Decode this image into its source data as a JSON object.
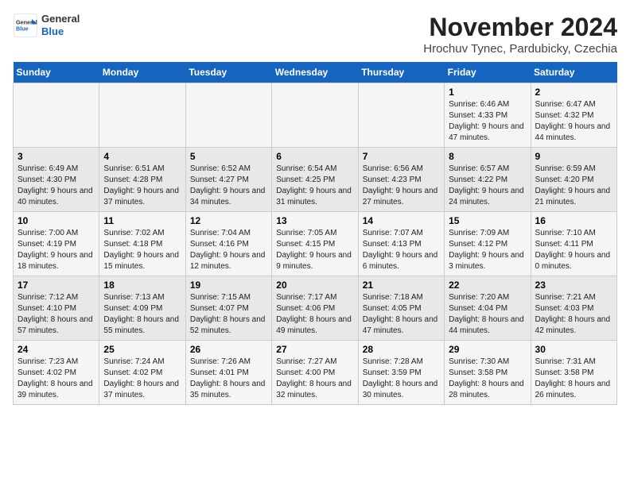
{
  "header": {
    "logo_line1": "General",
    "logo_line2": "Blue",
    "title": "November 2024",
    "subtitle": "Hrochuv Tynec, Pardubicky, Czechia"
  },
  "weekdays": [
    "Sunday",
    "Monday",
    "Tuesday",
    "Wednesday",
    "Thursday",
    "Friday",
    "Saturday"
  ],
  "weeks": [
    [
      {
        "day": "",
        "info": ""
      },
      {
        "day": "",
        "info": ""
      },
      {
        "day": "",
        "info": ""
      },
      {
        "day": "",
        "info": ""
      },
      {
        "day": "",
        "info": ""
      },
      {
        "day": "1",
        "info": "Sunrise: 6:46 AM\nSunset: 4:33 PM\nDaylight: 9 hours\nand 47 minutes."
      },
      {
        "day": "2",
        "info": "Sunrise: 6:47 AM\nSunset: 4:32 PM\nDaylight: 9 hours\nand 44 minutes."
      }
    ],
    [
      {
        "day": "3",
        "info": "Sunrise: 6:49 AM\nSunset: 4:30 PM\nDaylight: 9 hours\nand 40 minutes."
      },
      {
        "day": "4",
        "info": "Sunrise: 6:51 AM\nSunset: 4:28 PM\nDaylight: 9 hours\nand 37 minutes."
      },
      {
        "day": "5",
        "info": "Sunrise: 6:52 AM\nSunset: 4:27 PM\nDaylight: 9 hours\nand 34 minutes."
      },
      {
        "day": "6",
        "info": "Sunrise: 6:54 AM\nSunset: 4:25 PM\nDaylight: 9 hours\nand 31 minutes."
      },
      {
        "day": "7",
        "info": "Sunrise: 6:56 AM\nSunset: 4:23 PM\nDaylight: 9 hours\nand 27 minutes."
      },
      {
        "day": "8",
        "info": "Sunrise: 6:57 AM\nSunset: 4:22 PM\nDaylight: 9 hours\nand 24 minutes."
      },
      {
        "day": "9",
        "info": "Sunrise: 6:59 AM\nSunset: 4:20 PM\nDaylight: 9 hours\nand 21 minutes."
      }
    ],
    [
      {
        "day": "10",
        "info": "Sunrise: 7:00 AM\nSunset: 4:19 PM\nDaylight: 9 hours\nand 18 minutes."
      },
      {
        "day": "11",
        "info": "Sunrise: 7:02 AM\nSunset: 4:18 PM\nDaylight: 9 hours\nand 15 minutes."
      },
      {
        "day": "12",
        "info": "Sunrise: 7:04 AM\nSunset: 4:16 PM\nDaylight: 9 hours\nand 12 minutes."
      },
      {
        "day": "13",
        "info": "Sunrise: 7:05 AM\nSunset: 4:15 PM\nDaylight: 9 hours\nand 9 minutes."
      },
      {
        "day": "14",
        "info": "Sunrise: 7:07 AM\nSunset: 4:13 PM\nDaylight: 9 hours\nand 6 minutes."
      },
      {
        "day": "15",
        "info": "Sunrise: 7:09 AM\nSunset: 4:12 PM\nDaylight: 9 hours\nand 3 minutes."
      },
      {
        "day": "16",
        "info": "Sunrise: 7:10 AM\nSunset: 4:11 PM\nDaylight: 9 hours\nand 0 minutes."
      }
    ],
    [
      {
        "day": "17",
        "info": "Sunrise: 7:12 AM\nSunset: 4:10 PM\nDaylight: 8 hours\nand 57 minutes."
      },
      {
        "day": "18",
        "info": "Sunrise: 7:13 AM\nSunset: 4:09 PM\nDaylight: 8 hours\nand 55 minutes."
      },
      {
        "day": "19",
        "info": "Sunrise: 7:15 AM\nSunset: 4:07 PM\nDaylight: 8 hours\nand 52 minutes."
      },
      {
        "day": "20",
        "info": "Sunrise: 7:17 AM\nSunset: 4:06 PM\nDaylight: 8 hours\nand 49 minutes."
      },
      {
        "day": "21",
        "info": "Sunrise: 7:18 AM\nSunset: 4:05 PM\nDaylight: 8 hours\nand 47 minutes."
      },
      {
        "day": "22",
        "info": "Sunrise: 7:20 AM\nSunset: 4:04 PM\nDaylight: 8 hours\nand 44 minutes."
      },
      {
        "day": "23",
        "info": "Sunrise: 7:21 AM\nSunset: 4:03 PM\nDaylight: 8 hours\nand 42 minutes."
      }
    ],
    [
      {
        "day": "24",
        "info": "Sunrise: 7:23 AM\nSunset: 4:02 PM\nDaylight: 8 hours\nand 39 minutes."
      },
      {
        "day": "25",
        "info": "Sunrise: 7:24 AM\nSunset: 4:02 PM\nDaylight: 8 hours\nand 37 minutes."
      },
      {
        "day": "26",
        "info": "Sunrise: 7:26 AM\nSunset: 4:01 PM\nDaylight: 8 hours\nand 35 minutes."
      },
      {
        "day": "27",
        "info": "Sunrise: 7:27 AM\nSunset: 4:00 PM\nDaylight: 8 hours\nand 32 minutes."
      },
      {
        "day": "28",
        "info": "Sunrise: 7:28 AM\nSunset: 3:59 PM\nDaylight: 8 hours\nand 30 minutes."
      },
      {
        "day": "29",
        "info": "Sunrise: 7:30 AM\nSunset: 3:58 PM\nDaylight: 8 hours\nand 28 minutes."
      },
      {
        "day": "30",
        "info": "Sunrise: 7:31 AM\nSunset: 3:58 PM\nDaylight: 8 hours\nand 26 minutes."
      }
    ]
  ]
}
